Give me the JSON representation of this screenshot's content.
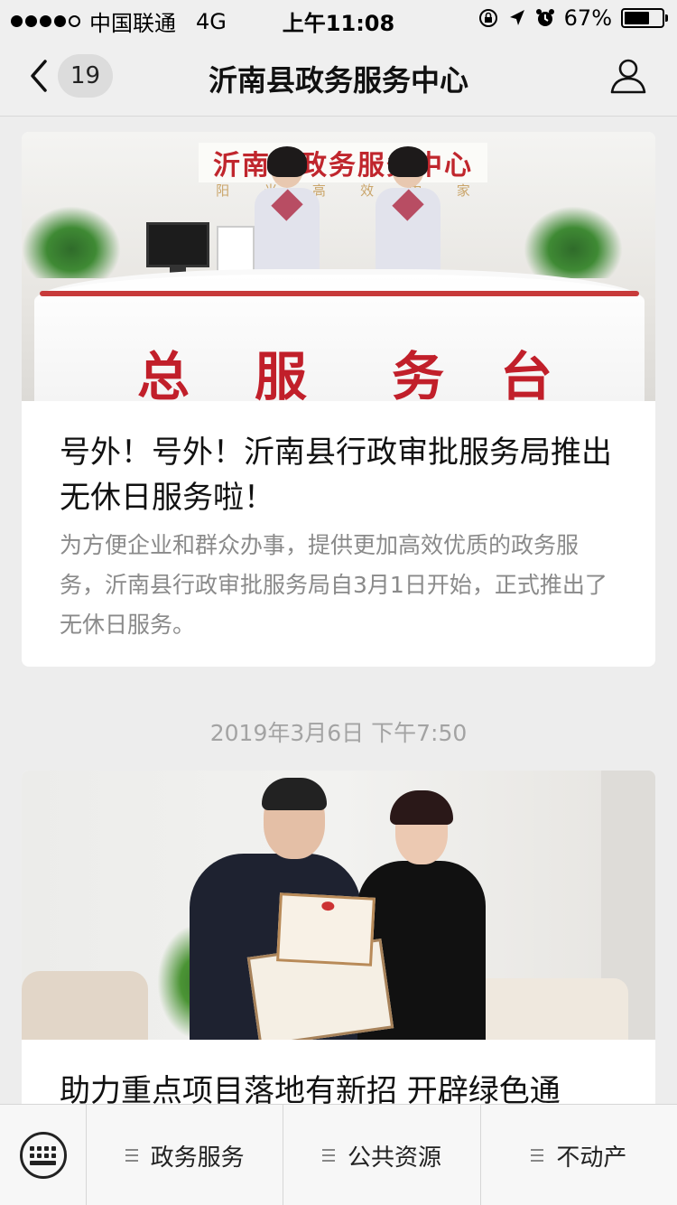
{
  "status_bar": {
    "carrier": "中国联通",
    "network": "4G",
    "time": "上午11:08",
    "battery": "67%",
    "battery_level": 0.67,
    "signal_bars": 4,
    "signal_total": 5
  },
  "nav": {
    "back_count": "19",
    "title": "沂南县政务服务中心",
    "back_icon": "chevron-left-icon",
    "profile_icon": "person-icon"
  },
  "articles": [
    {
      "image_sign": "沂南县政务服务中心",
      "image_sub": [
        "阳",
        "光",
        "高",
        "效",
        "中",
        "家"
      ],
      "image_desk_chars": [
        "总",
        "服",
        "务",
        "台"
      ],
      "title": "号外！号外！沂南县行政审批服务局推出无休日服务啦！",
      "description": "为方便企业和群众办事，提供更加高效优质的政务服务，沂南县行政审批服务局自3月1日开始，正式推出了无休日服务。"
    },
    {
      "title": "助力重点项目落地有新招 开辟绿色通"
    }
  ],
  "timestamp": "2019年3月6日 下午7:50",
  "bottom_menu": {
    "keyboard_icon": "keyboard-icon",
    "items": [
      "政务服务",
      "公共资源",
      "不动产"
    ]
  },
  "colors": {
    "accent_red": "#c11f2a",
    "background": "#ededed"
  }
}
